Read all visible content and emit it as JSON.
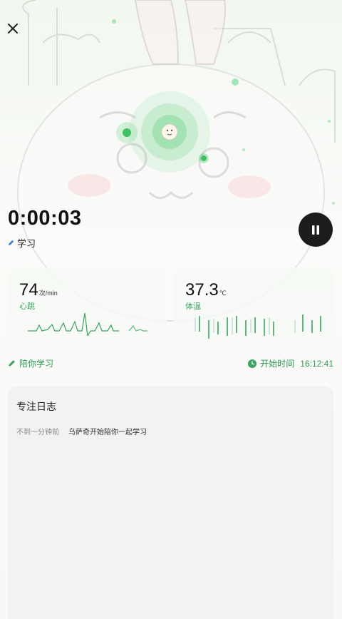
{
  "header": {
    "close_icon": "close-icon"
  },
  "session": {
    "timer": "0:00:03",
    "subject_icon": "pen-icon",
    "subject": "学习"
  },
  "controls": {
    "pause_icon": "pause-icon"
  },
  "metrics": {
    "heart_rate": {
      "value": "74",
      "unit": "次/min",
      "label": "心跳"
    },
    "temperature": {
      "value": "37.3",
      "unit": "℃",
      "label": "体温"
    }
  },
  "companion": {
    "icon": "pencil-icon",
    "label": "陪你学习"
  },
  "start": {
    "icon": "clock-icon",
    "label": "开始时间",
    "time": "16:12:41"
  },
  "log": {
    "title": "专注日志",
    "entries": [
      {
        "time": "不到一分钟前",
        "text": "乌萨奇开始陪你一起学习"
      }
    ]
  },
  "colors": {
    "accent": "#3aa55c",
    "pause_bg": "#1d1d1d",
    "radar": "#5fd07d"
  }
}
